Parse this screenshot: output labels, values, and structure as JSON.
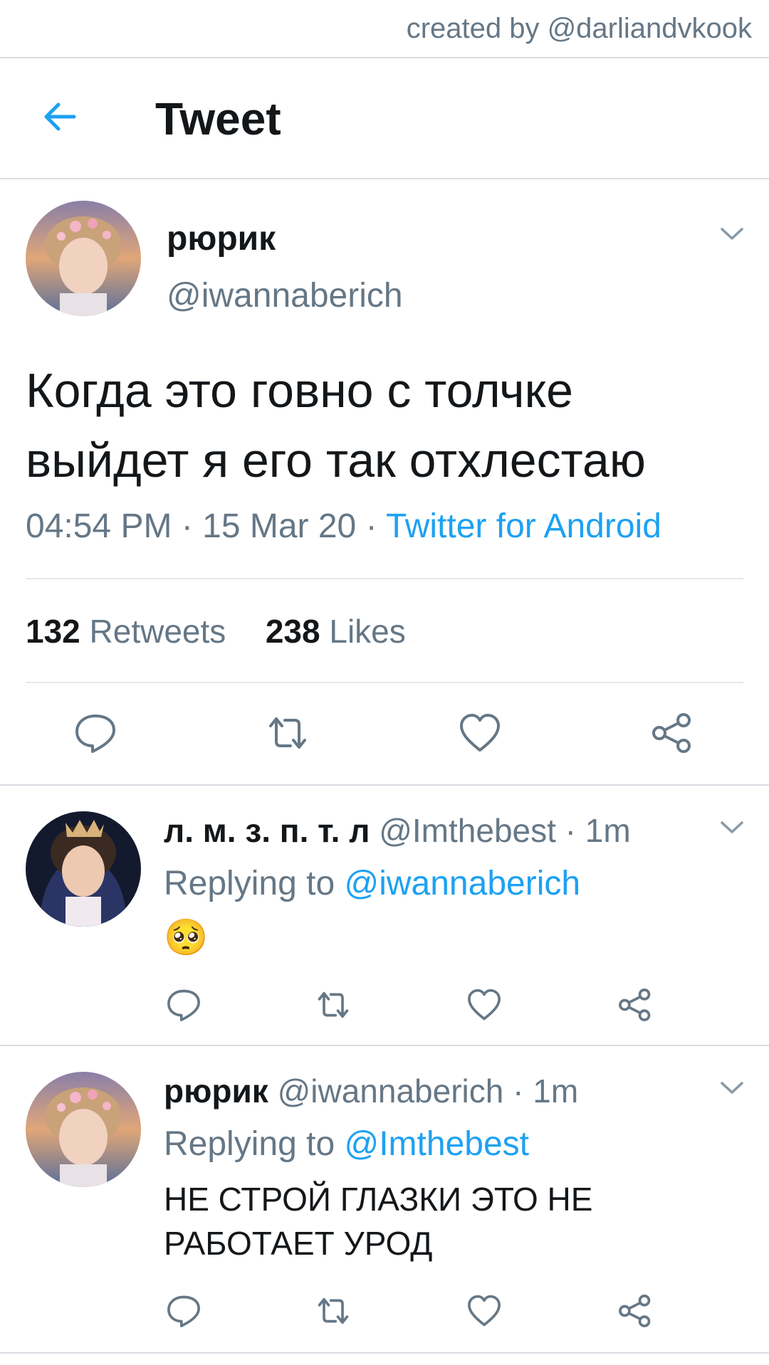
{
  "watermark": "created by @darliandvkook",
  "header": {
    "title": "Tweet"
  },
  "main_tweet": {
    "name": "рюрик",
    "handle": "@iwannaberich",
    "text": "Когда это говно с толчке выйдет я его так отхлестаю",
    "time": "04:54 PM",
    "date": "15 Mar 20",
    "source": "Twitter for Android",
    "retweets_count": "132",
    "retweets_label": "Retweets",
    "likes_count": "238",
    "likes_label": "Likes"
  },
  "replies": [
    {
      "name": "л. м. з. п. т. л",
      "handle": "@Imthebest",
      "time": "1m",
      "replying_prefix": "Replying to",
      "replying_to": "@iwannaberich",
      "text": "🥺"
    },
    {
      "name": "рюрик",
      "handle": "@iwannaberich",
      "time": "1m",
      "replying_prefix": "Replying to",
      "replying_to": "@Imthebest",
      "text": "НЕ СТРОЙ ГЛАЗКИ ЭТО НЕ РАБОТАЕТ УРОД"
    }
  ],
  "colors": {
    "accent": "#1da1f2",
    "secondary": "#657786",
    "text": "#14171a"
  },
  "icons": [
    "back-arrow-icon",
    "chevron-down-icon",
    "reply-icon",
    "retweet-icon",
    "like-icon",
    "share-icon"
  ]
}
